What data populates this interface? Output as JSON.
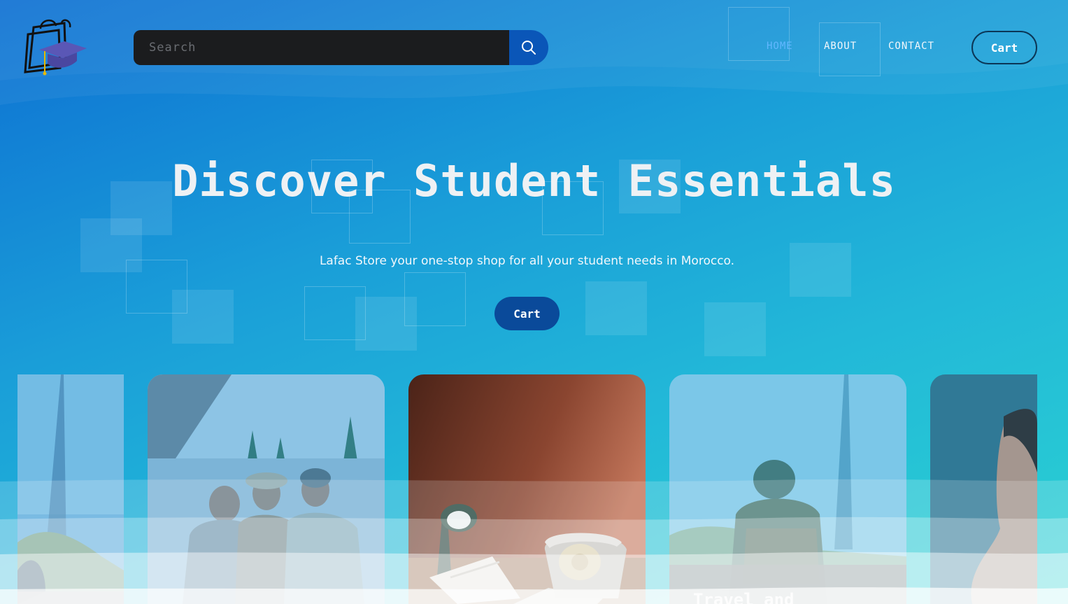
{
  "header": {
    "search_placeholder": "Search",
    "nav": [
      {
        "label": "HOME",
        "active": true
      },
      {
        "label": "ABOUT",
        "active": false
      },
      {
        "label": "CONTACT",
        "active": false
      }
    ],
    "cart_label": "Cart"
  },
  "hero": {
    "title": "Discover Student Essentials",
    "subtitle": "Lafac Store your one-stop shop for all your student needs in Morocco.",
    "cta_label": "Cart"
  },
  "cards": [
    {
      "caption": ""
    },
    {
      "caption": ""
    },
    {
      "caption": ""
    },
    {
      "caption": "Travel and"
    },
    {
      "caption": ""
    }
  ],
  "icons": {
    "logo": "graduation-cap-shopping-bag-logo",
    "search": "search-icon"
  },
  "colors": {
    "accent_blue": "#0a56b8",
    "nav_active": "#62b7ff",
    "search_bg": "#1b1c1e",
    "cta_bg": "#0a4a9a"
  }
}
